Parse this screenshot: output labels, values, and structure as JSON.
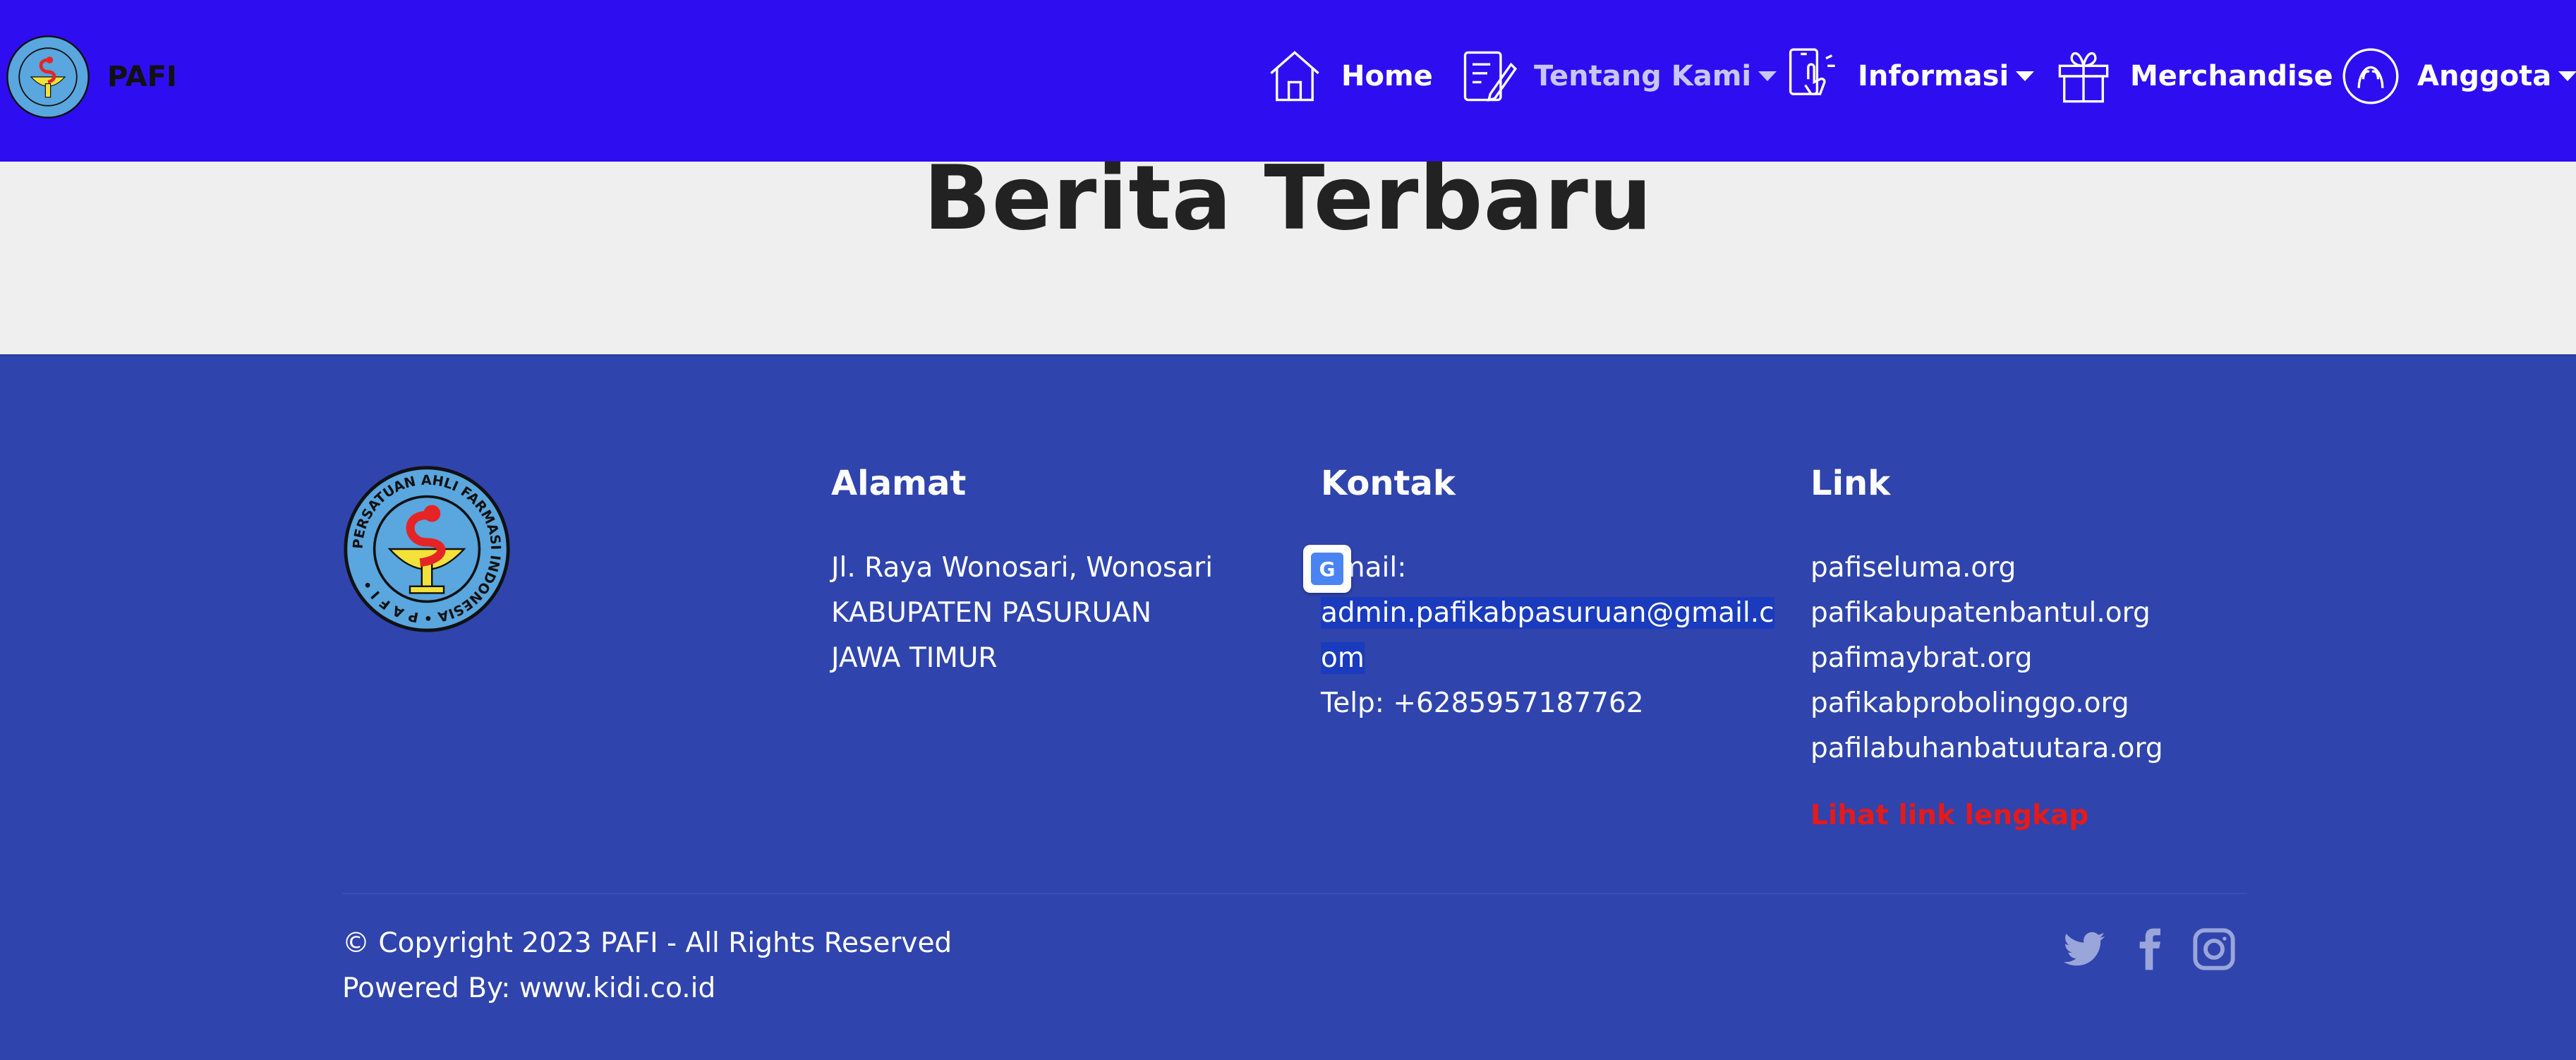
{
  "header": {
    "brand": "PAFI",
    "nav": [
      {
        "label": "Home",
        "icon": "home-icon"
      },
      {
        "label": "Tentang Kami",
        "icon": "document-edit-icon",
        "dropdown": true
      },
      {
        "label": "Informasi",
        "icon": "phone-touch-icon",
        "dropdown": true
      },
      {
        "label": "Merchandise",
        "icon": "gift-icon"
      },
      {
        "label": "Anggota",
        "icon": "members-icon",
        "dropdown": true
      }
    ]
  },
  "hero": {
    "title": "Berita Terbaru"
  },
  "footer": {
    "alamat": {
      "heading": "Alamat",
      "lines": [
        "Jl. Raya Wonosari, Wonosari",
        "KABUPATEN PASURUAN",
        "JAWA TIMUR"
      ]
    },
    "kontak": {
      "heading": "Kontak",
      "email_label": "Email:",
      "email_line1": "admin.pafikabpasuruan@gmail.c",
      "email_line2": "om",
      "phone": "Telp: +6285957187762"
    },
    "link": {
      "heading": "Link",
      "items": [
        "pafiseluma.org",
        "pafikabupatenbantul.org",
        "pafimaybrat.org",
        "pafikabprobolinggo.org",
        "pafilabuhanbatuutara.org"
      ],
      "more": "Lihat link lengkap"
    },
    "copyright": "© Copyright 2023 PAFI - All Rights Reserved",
    "powered": "Powered By: www.kidi.co.id",
    "social": [
      "twitter-icon",
      "facebook-icon",
      "instagram-icon"
    ]
  },
  "colors": {
    "header_bg": "#2e0ef0",
    "footer_bg": "#2f44ad",
    "hero_bg": "#efefef",
    "link_red": "#e51a1a"
  },
  "logo_text": "PERSATUAN AHLI FARMASI INDONESIA • P A F I •"
}
